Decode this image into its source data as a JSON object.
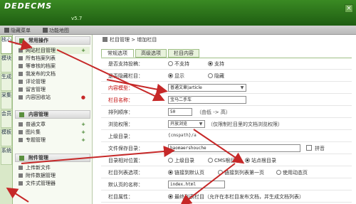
{
  "header": {
    "logo": "DEDECMS",
    "version": "v5.7",
    "close": "×"
  },
  "quickbar": {
    "items": [
      "隐藏菜单",
      "功能地图"
    ]
  },
  "vtabs": [
    "核心",
    "模块",
    "生成",
    "采集",
    "会员",
    "模板",
    "系统"
  ],
  "menu": {
    "sections": [
      {
        "title": "常用操作",
        "items": [
          "网站栏目管理",
          "所有档案列表",
          "等审核的档案",
          "我发布的文档",
          "评论管理",
          "留言管理",
          "内容回收站"
        ]
      },
      {
        "title": "内容管理",
        "items": [
          "普通文章",
          "图片集",
          "专题管理"
        ]
      },
      {
        "title": "附件管理",
        "items": [
          "上传新文件",
          "附件数据管理",
          "文件式管理器"
        ]
      }
    ]
  },
  "breadcrumb": {
    "root": "栏目管理",
    "sep": " > ",
    "current": "增加栏目"
  },
  "tabs": [
    "常规选项",
    "高级选项",
    "栏目内容"
  ],
  "form": {
    "rows": [
      {
        "label": "是否支持投稿：",
        "options": [
          "不支持",
          "支持"
        ]
      },
      {
        "label": "是否隐藏栏目：",
        "options": [
          "显示",
          "隐藏"
        ]
      },
      {
        "label": "内容模型：",
        "select": "普通文章|article"
      },
      {
        "label": "栏目名称：",
        "value": "宝马二手车"
      },
      {
        "label": "排列顺序：",
        "value": "50",
        "hint": "（由低 -> 高）"
      },
      {
        "label": "浏览权限：",
        "select": "开放浏览",
        "hint": "（仅限制栏目里的文档浏览权限）"
      },
      {
        "label": "上级目录：",
        "value": "{cmspath}/a"
      },
      {
        "label": "文件保存目录：",
        "value": "baomaershouche",
        "check_label": "拼音"
      },
      {
        "label": "目录相对位置：",
        "options": [
          "上级目录",
          "CMS根目录",
          "站点根目录"
        ]
      },
      {
        "label": "栏目列表选项：",
        "options": [
          "链接到默认页",
          "链接到列表第一页",
          "使用动态页"
        ]
      },
      {
        "label": "默认页的名称：",
        "value": "index.html"
      },
      {
        "label": "栏目属性：",
        "options": [
          "最终列表栏目（允许在本栏目发布文档，并生成文档列表）"
        ]
      }
    ]
  },
  "colors": {
    "accent": "#c62828",
    "header": "#2e7a1b"
  }
}
